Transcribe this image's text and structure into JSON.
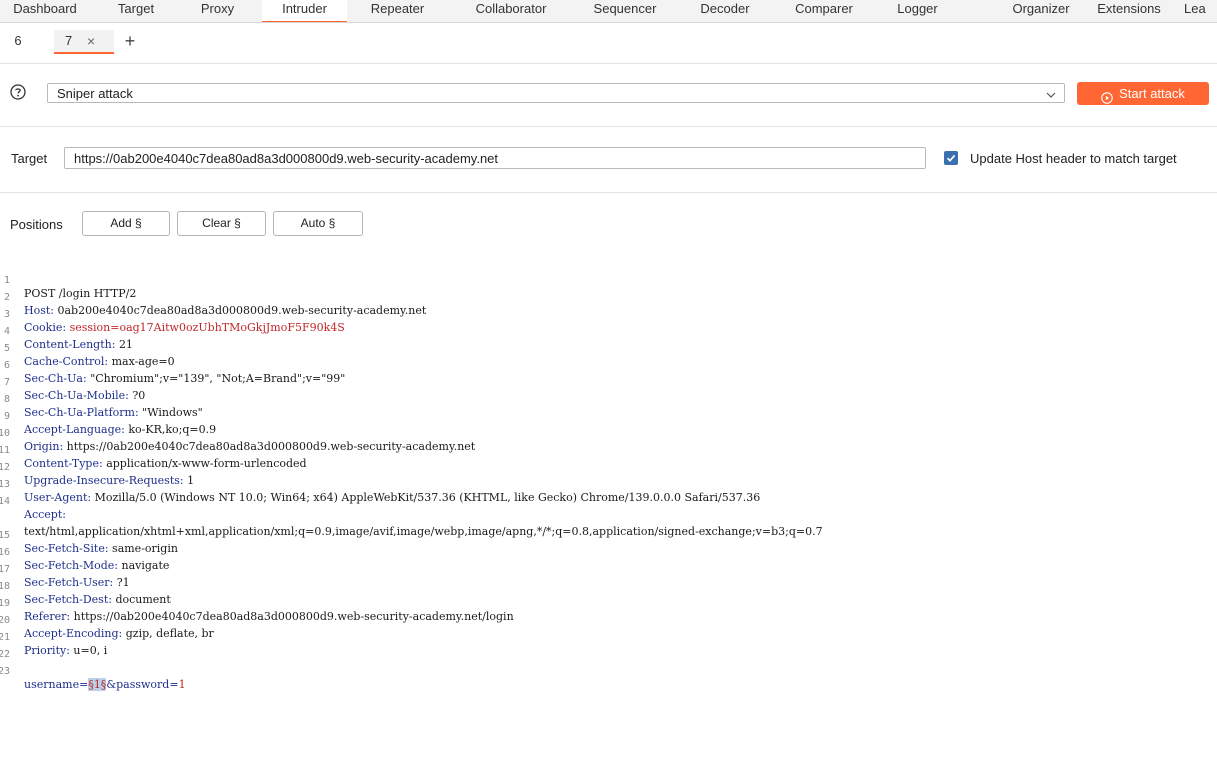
{
  "nav": {
    "items": [
      "Dashboard",
      "Target",
      "Proxy",
      "Intruder",
      "Repeater",
      "Collaborator",
      "Sequencer",
      "Decoder",
      "Comparer",
      "Logger",
      "Organizer",
      "Extensions",
      "Lea"
    ],
    "active": "Intruder"
  },
  "tabs": {
    "items": [
      "6",
      "7"
    ],
    "close": "×",
    "add": "+"
  },
  "attack": {
    "help_icon": "help-circle-icon",
    "type": "Sniper attack",
    "start_label": "Start attack"
  },
  "target": {
    "label": "Target",
    "url": "https://0ab200e4040c7dea80ad8a3d000800d9.web-security-academy.net",
    "update_host_label": "Update Host header to match target",
    "update_host_checked": true
  },
  "positions": {
    "label": "Positions",
    "add_label": "Add §",
    "clear_label": "Clear §",
    "auto_label": "Auto §"
  },
  "request": {
    "line_numbers": [
      "1",
      "2",
      "3",
      "4",
      "5",
      "6",
      "7",
      "8",
      "9",
      "10",
      "11",
      "12",
      "13",
      "14",
      "",
      "15",
      "16",
      "17",
      "18",
      "19",
      "20",
      "21",
      "22",
      "23"
    ],
    "request_line": "POST /login HTTP/2",
    "headers": [
      {
        "name": "Host",
        "value": "0ab200e4040c7dea80ad8a3d000800d9.web-security-academy.net"
      },
      {
        "name": "Cookie",
        "value": "session=oag17Aitw0ozUbhTMoGkjJmoF5F90k4S"
      },
      {
        "name": "Content-Length",
        "value": "21"
      },
      {
        "name": "Cache-Control",
        "value": "max-age=0"
      },
      {
        "name": "Sec-Ch-Ua",
        "value": "\"Chromium\";v=\"139\", \"Not;A=Brand\";v=\"99\""
      },
      {
        "name": "Sec-Ch-Ua-Mobile",
        "value": "?0"
      },
      {
        "name": "Sec-Ch-Ua-Platform",
        "value": "\"Windows\""
      },
      {
        "name": "Accept-Language",
        "value": "ko-KR,ko;q=0.9"
      },
      {
        "name": "Origin",
        "value": "https://0ab200e4040c7dea80ad8a3d000800d9.web-security-academy.net"
      },
      {
        "name": "Content-Type",
        "value": "application/x-www-form-urlencoded"
      },
      {
        "name": "Upgrade-Insecure-Requests",
        "value": "1"
      },
      {
        "name": "User-Agent",
        "value": "Mozilla/5.0 (Windows NT 10.0; Win64; x64) AppleWebKit/537.36 (KHTML, like Gecko) Chrome/139.0.0.0 Safari/537.36"
      },
      {
        "name": "Accept",
        "value": ""
      },
      {
        "name": "",
        "value": "text/html,application/xhtml+xml,application/xml;q=0.9,image/avif,image/webp,image/apng,*/*;q=0.8,application/signed-exchange;v=b3;q=0.7"
      },
      {
        "name": "Sec-Fetch-Site",
        "value": "same-origin"
      },
      {
        "name": "Sec-Fetch-Mode",
        "value": "navigate"
      },
      {
        "name": "Sec-Fetch-User",
        "value": "?1"
      },
      {
        "name": "Sec-Fetch-Dest",
        "value": "document"
      },
      {
        "name": "Referer",
        "value": "https://0ab200e4040c7dea80ad8a3d000800d9.web-security-academy.net/login"
      },
      {
        "name": "Accept-Encoding",
        "value": "gzip, deflate, br"
      },
      {
        "name": "Priority",
        "value": "u=0, i"
      }
    ],
    "body": {
      "username_key": "username=",
      "payload": "§1§",
      "rest_key": "&password=",
      "rest_value": "1"
    }
  },
  "colors": {
    "accent": "#ff6633",
    "header_name": "#1e2f8c",
    "value_red": "#c0282a",
    "payload_bg": "#b9d1ea",
    "checkbox": "#3a6fb0"
  }
}
